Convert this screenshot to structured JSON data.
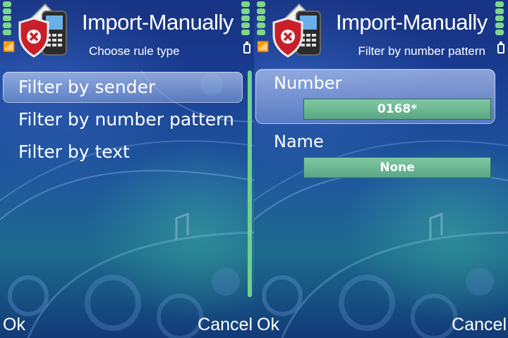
{
  "screens": [
    {
      "header": {
        "title": "Import-Manually",
        "subtitle": "Choose rule type"
      },
      "menu": [
        {
          "label": "Filter by sender",
          "selected": true
        },
        {
          "label": "Filter by number pattern",
          "selected": false
        },
        {
          "label": "Filter by text",
          "selected": false
        }
      ],
      "softkeys": {
        "left": "Ok",
        "right": "Cancel"
      }
    },
    {
      "header": {
        "title": "Import-Manually",
        "subtitle": "Filter by number pattern"
      },
      "form": {
        "number_label": "Number",
        "number_value": "0168*",
        "name_label": "Name",
        "name_value": "None"
      },
      "softkeys": {
        "left": "Ok",
        "right": "Cancel"
      }
    }
  ],
  "status": {
    "signal_bars": 5,
    "battery_bars": 5,
    "signal_icon": "antenna-icon",
    "battery_icon": "battery-icon",
    "bar_color": "#7dd78a"
  },
  "app_icon": "shield-phone-icon",
  "colors": {
    "highlight": "#a9bbe6",
    "field_bg": "#6fb895",
    "scroll_thumb": "#6fd189"
  }
}
